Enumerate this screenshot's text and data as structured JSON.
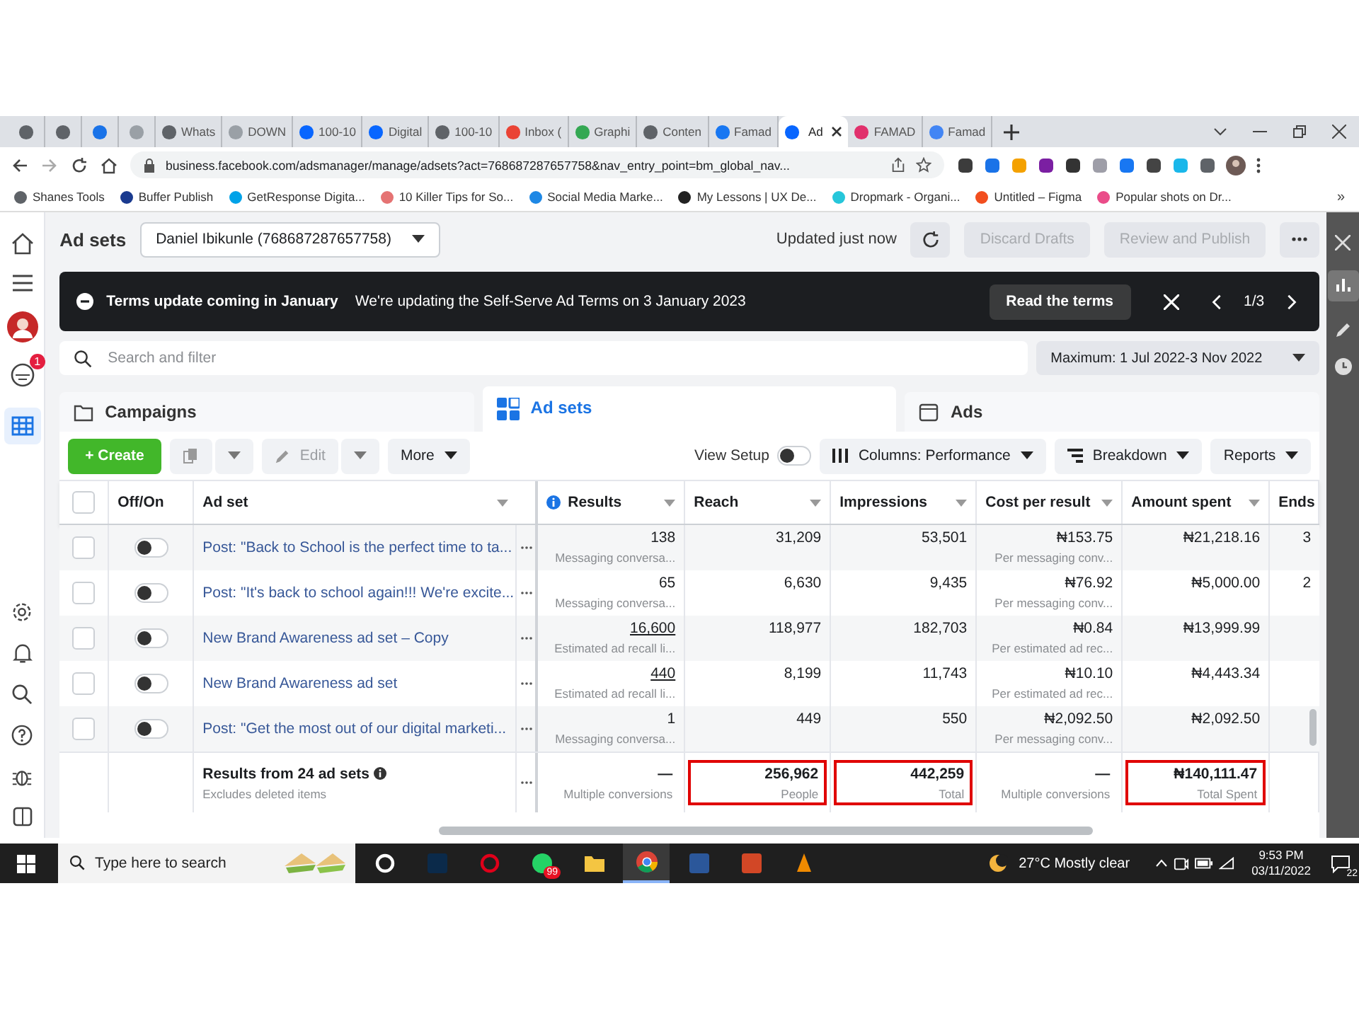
{
  "browser": {
    "tabs": [
      {
        "color": "#5f6368",
        "selected": false
      },
      {
        "color": "#5f6368",
        "selected": false
      },
      {
        "color": "#1a73e8",
        "selected": false
      },
      {
        "color": "#9aa0a6",
        "selected": false
      },
      {
        "label": "Whats",
        "color": "#5f6368",
        "selected": false
      },
      {
        "label": "DOWN",
        "color": "#9aa0a6",
        "selected": false
      },
      {
        "label": "100-10",
        "color": "#0866ff",
        "selected": false
      },
      {
        "label": "Digital",
        "color": "#0866ff",
        "selected": false
      },
      {
        "label": "100-10",
        "color": "#5f6368",
        "selected": false
      },
      {
        "label": "Inbox (",
        "color": "#ea4335",
        "selected": false
      },
      {
        "label": "Graphi",
        "color": "#34a853",
        "selected": false
      },
      {
        "label": "Conten",
        "color": "#5f6368",
        "selected": false
      },
      {
        "label": "Famad",
        "color": "#1877f2",
        "selected": false
      },
      {
        "label": "Ad",
        "color": "#0866ff",
        "selected": true
      },
      {
        "label": "FAMAD",
        "color": "#e1306c",
        "selected": false
      },
      {
        "label": "Famad",
        "color": "#4285f4",
        "selected": false
      }
    ],
    "url": "business.facebook.com/adsmanager/manage/adsets?act=768687287657758&nav_entry_point=bm_global_nav...",
    "bookmarks": [
      {
        "label": "Shanes Tools",
        "color": "#5f6368"
      },
      {
        "label": "Buffer Publish",
        "color": "#1a3a8f"
      },
      {
        "label": "GetResponse Digita...",
        "color": "#00a2e8"
      },
      {
        "label": "10 Killer Tips for So...",
        "color": "#e57373"
      },
      {
        "label": "Social Media Marke...",
        "color": "#1e88e5"
      },
      {
        "label": "My Lessons | UX De...",
        "color": "#222222"
      },
      {
        "label": "Dropmark - Organi...",
        "color": "#26c6da"
      },
      {
        "label": "Untitled – Figma",
        "color": "#f24e1e"
      },
      {
        "label": "Popular shots on Dr...",
        "color": "#ea4c89"
      }
    ],
    "bookmarks_more": "»"
  },
  "app": {
    "notification_badge": "1",
    "title": "Ad sets",
    "account": "Daniel Ibikunle (768687287657758)",
    "updated": "Updated just now",
    "header_buttons": [
      {
        "label": "Discard Drafts",
        "disabled": true
      },
      {
        "label": "Review and Publish",
        "disabled": true
      }
    ],
    "banner": {
      "title": "Terms update coming in January",
      "message": "We're updating the Self-Serve Ad Terms on 3 January 2023",
      "button": "Read the terms",
      "pager": "1/3"
    },
    "search": {
      "placeholder": "Search and filter"
    },
    "date_range": "Maximum: 1 Jul 2022-3 Nov 2022",
    "nav_tabs": [
      {
        "label": "Campaigns",
        "selected": false
      },
      {
        "label": "Ad sets",
        "selected": true
      },
      {
        "label": "Ads",
        "selected": false
      }
    ],
    "toolbar": {
      "create": "+ Create",
      "edit": "Edit",
      "edit_disabled": true,
      "more": "More",
      "view_setup": "View Setup",
      "view_setup_on": false,
      "columns": "Columns: Performance",
      "breakdown": "Breakdown",
      "reports": "Reports"
    }
  },
  "table": {
    "select_all_checked": false,
    "columns": [
      {
        "label": "Off/On",
        "info": false,
        "sortable": false
      },
      {
        "label": "Ad set",
        "info": false,
        "sortable": true
      },
      {
        "label": "Results",
        "info": true,
        "sortable": true
      },
      {
        "label": "Reach",
        "info": false,
        "sortable": true
      },
      {
        "label": "Impressions",
        "info": false,
        "sortable": true
      },
      {
        "label": "Cost per result",
        "info": false,
        "sortable": true
      },
      {
        "label": "Amount spent",
        "info": false,
        "sortable": true
      },
      {
        "label": "Ends",
        "info": false
      }
    ],
    "rows": [
      {
        "checked": false,
        "on": false,
        "name": "Post: \"Back to School is the perfect time to ta...",
        "results": "138",
        "results_link": false,
        "results_sub": "Messaging conversa...",
        "reach": "31,209",
        "impressions": "53,501",
        "cost": "₦153.75",
        "cost_sub": "Per messaging conv...",
        "spent": "₦21,218.16",
        "ends": "3"
      },
      {
        "checked": false,
        "on": false,
        "name": "Post: \"It's back to school again!!! We're excite...",
        "results": "65",
        "results_link": false,
        "results_sub": "Messaging conversa...",
        "reach": "6,630",
        "impressions": "9,435",
        "cost": "₦76.92",
        "cost_sub": "Per messaging conv...",
        "spent": "₦5,000.00",
        "ends": "2"
      },
      {
        "checked": false,
        "on": false,
        "name": "New Brand Awareness ad set – Copy",
        "results": "16,600",
        "results_link": true,
        "results_sub": "Estimated ad recall li...",
        "reach": "118,977",
        "impressions": "182,703",
        "cost": "₦0.84",
        "cost_sub": "Per estimated ad rec...",
        "spent": "₦13,999.99"
      },
      {
        "checked": false,
        "on": false,
        "name": "New Brand Awareness ad set",
        "results": "440",
        "results_link": true,
        "results_sub": "Estimated ad recall li...",
        "reach": "8,199",
        "impressions": "11,743",
        "cost": "₦10.10",
        "cost_sub": "Per estimated ad rec...",
        "spent": "₦4,443.34"
      },
      {
        "checked": false,
        "on": false,
        "name": "Post: \"Get the most out of our digital marketi...",
        "results": "1",
        "results_link": false,
        "results_sub": "Messaging conversa...",
        "reach": "449",
        "impressions": "550",
        "cost": "₦2,092.50",
        "cost_sub": "Per messaging conv...",
        "spent": "₦2,092.50"
      }
    ],
    "totals": {
      "label": "Results from 24 ad sets",
      "sub": "Excludes deleted items",
      "cells": [
        {
          "value": "—",
          "sub": "Multiple conversions",
          "highlighted": false
        },
        {
          "value": "256,962",
          "sub": "People",
          "highlighted": true
        },
        {
          "value": "442,259",
          "sub": "Total",
          "highlighted": true
        },
        {
          "value": "—",
          "sub": "Multiple conversions",
          "highlighted": false
        },
        {
          "value": "₦140,111.47",
          "sub": "Total Spent",
          "highlighted": true
        }
      ]
    }
  },
  "taskbar": {
    "search_placeholder": "Type here to search",
    "apps": [
      {
        "kind": "cortana",
        "selected": false
      },
      {
        "kind": "photoshop",
        "selected": false
      },
      {
        "kind": "opera",
        "selected": false
      },
      {
        "kind": "whatsapp",
        "selected": false,
        "badge": "99"
      },
      {
        "kind": "explorer",
        "selected": false
      },
      {
        "kind": "chrome",
        "selected": true
      },
      {
        "kind": "word",
        "selected": false
      },
      {
        "kind": "powerpoint",
        "selected": false
      },
      {
        "kind": "vlc",
        "selected": false
      }
    ],
    "weather": "27°C Mostly clear",
    "time": "9:53 PM",
    "date": "03/11/2022",
    "notifications": "22"
  }
}
